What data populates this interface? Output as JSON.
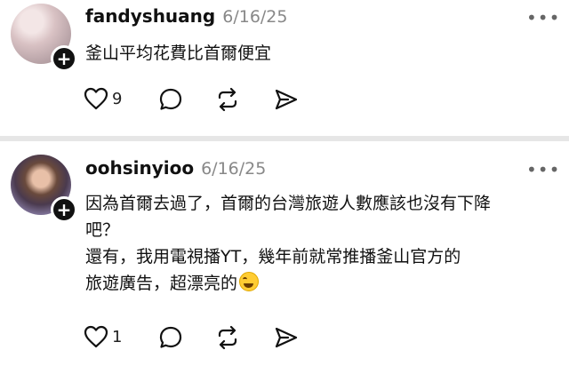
{
  "posts": [
    {
      "username": "fandyshuang",
      "date": "6/16/25",
      "more_label": "•••",
      "lines": [
        "釜山平均花費比首爾便宜"
      ],
      "like_count": "9"
    },
    {
      "username": "oohsinyioo",
      "date": "6/16/25",
      "more_label": "•••",
      "lines": [
        "因為首爾去過了，首爾的台灣旅遊人數應該也沒有下降",
        "吧？",
        "還有，我用電視播YT，幾年前就常推播釜山官方的",
        "旅遊廣告，超漂亮的"
      ],
      "emoji": "grinning-squinting-face",
      "like_count": "1"
    }
  ],
  "follow_icon": "plus-icon",
  "action_icons": [
    "heart-icon",
    "comment-icon",
    "repost-icon",
    "share-icon"
  ]
}
